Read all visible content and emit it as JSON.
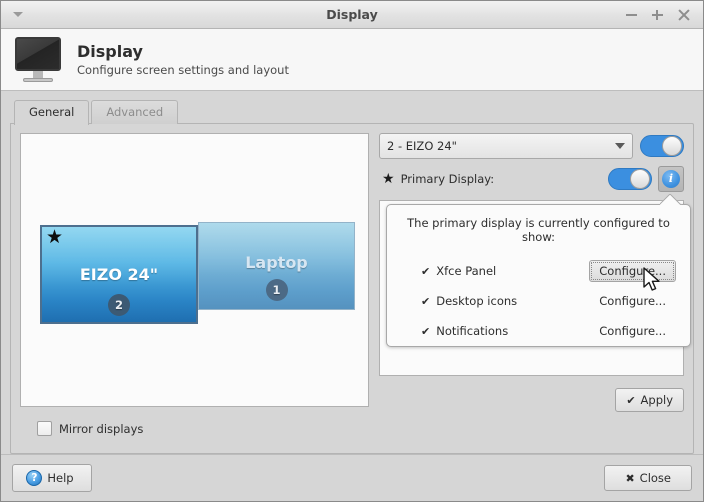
{
  "window": {
    "title": "Display",
    "menu_icon": "chevron-down-icon",
    "minimize_label": "–",
    "maximize_label": "+",
    "close_label": "×"
  },
  "header": {
    "icon": "monitor-icon",
    "title": "Display",
    "subtitle": "Configure screen settings and layout"
  },
  "tabs": [
    {
      "label": "General",
      "active": true
    },
    {
      "label": "Advanced",
      "active": false
    }
  ],
  "preview": {
    "screens": [
      {
        "name": "EIZO 24\"",
        "number": "2",
        "primary": true,
        "star_icon": "star-icon"
      },
      {
        "name": "Laptop",
        "number": "1",
        "primary": false
      }
    ]
  },
  "controls": {
    "display_combo": {
      "value": "2 - EIZO 24\"",
      "arrow_icon": "chevron-down-icon"
    },
    "display_enabled": true,
    "primary": {
      "star_icon": "star-icon",
      "label": "Primary Display:",
      "enabled": true,
      "info_icon": "info-icon",
      "info_glyph": "i"
    },
    "apply": {
      "label": "Apply",
      "check_icon": "check-icon",
      "check_glyph": "✔"
    }
  },
  "popover": {
    "title": "The primary display is currently configured to show:",
    "items": [
      {
        "check_glyph": "✔",
        "label": "Xfce Panel",
        "action": "Configure...",
        "focused": true
      },
      {
        "check_glyph": "✔",
        "label": "Desktop icons",
        "action": "Configure...",
        "focused": false
      },
      {
        "check_glyph": "✔",
        "label": "Notifications",
        "action": "Configure...",
        "focused": false
      }
    ]
  },
  "mirror": {
    "label": "Mirror displays",
    "checked": false
  },
  "actions": {
    "help": {
      "label": "Help",
      "icon_glyph": "?"
    },
    "close": {
      "label": "Close",
      "icon_glyph": "✖"
    }
  },
  "colors": {
    "accent_blue": "#3b8fe0",
    "window_bg": "#d6d6d6",
    "panel_bg": "#fbfbfb",
    "screen_primary": "#2a84c6",
    "screen_secondary": "#5d9ecb"
  }
}
